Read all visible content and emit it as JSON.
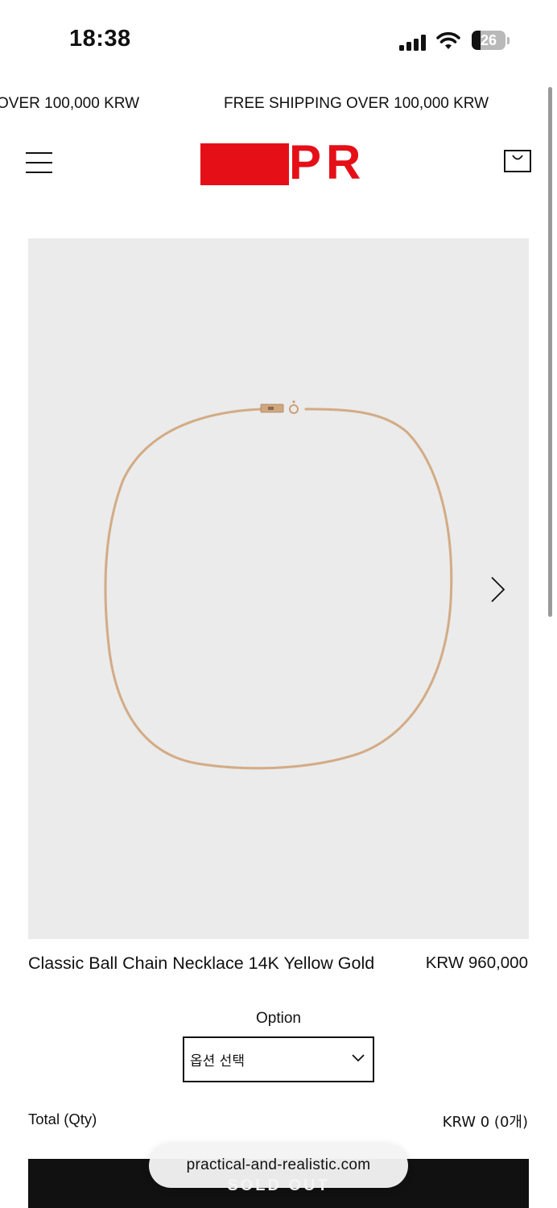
{
  "status_bar": {
    "time": "18:38",
    "battery_level": "26",
    "icons": [
      "signal-icon",
      "wifi-icon",
      "battery-icon"
    ]
  },
  "announcement": {
    "text_partial": "OVER 100,000 KRW",
    "text": "FREE SHIPPING OVER 100,000 KRW"
  },
  "header": {
    "logo_text": "PR",
    "brand_color": "#e50f18",
    "icons": [
      "menu-icon",
      "shopping-bag-icon"
    ]
  },
  "product": {
    "title": "Classic Ball Chain Necklace 14K Yellow Gold",
    "price": "KRW 960,000",
    "image_background": "#ebebeb",
    "chain_color": "#d4b08c",
    "gallery_icon": "chevron-right-icon"
  },
  "option": {
    "label": "Option",
    "selected": "옵션 선택"
  },
  "total": {
    "label": "Total (Qty)",
    "value": "KRW 0 (0개)"
  },
  "purchase": {
    "button_label": "SOLD OUT"
  },
  "browser": {
    "url": "practical-and-realistic.com"
  }
}
